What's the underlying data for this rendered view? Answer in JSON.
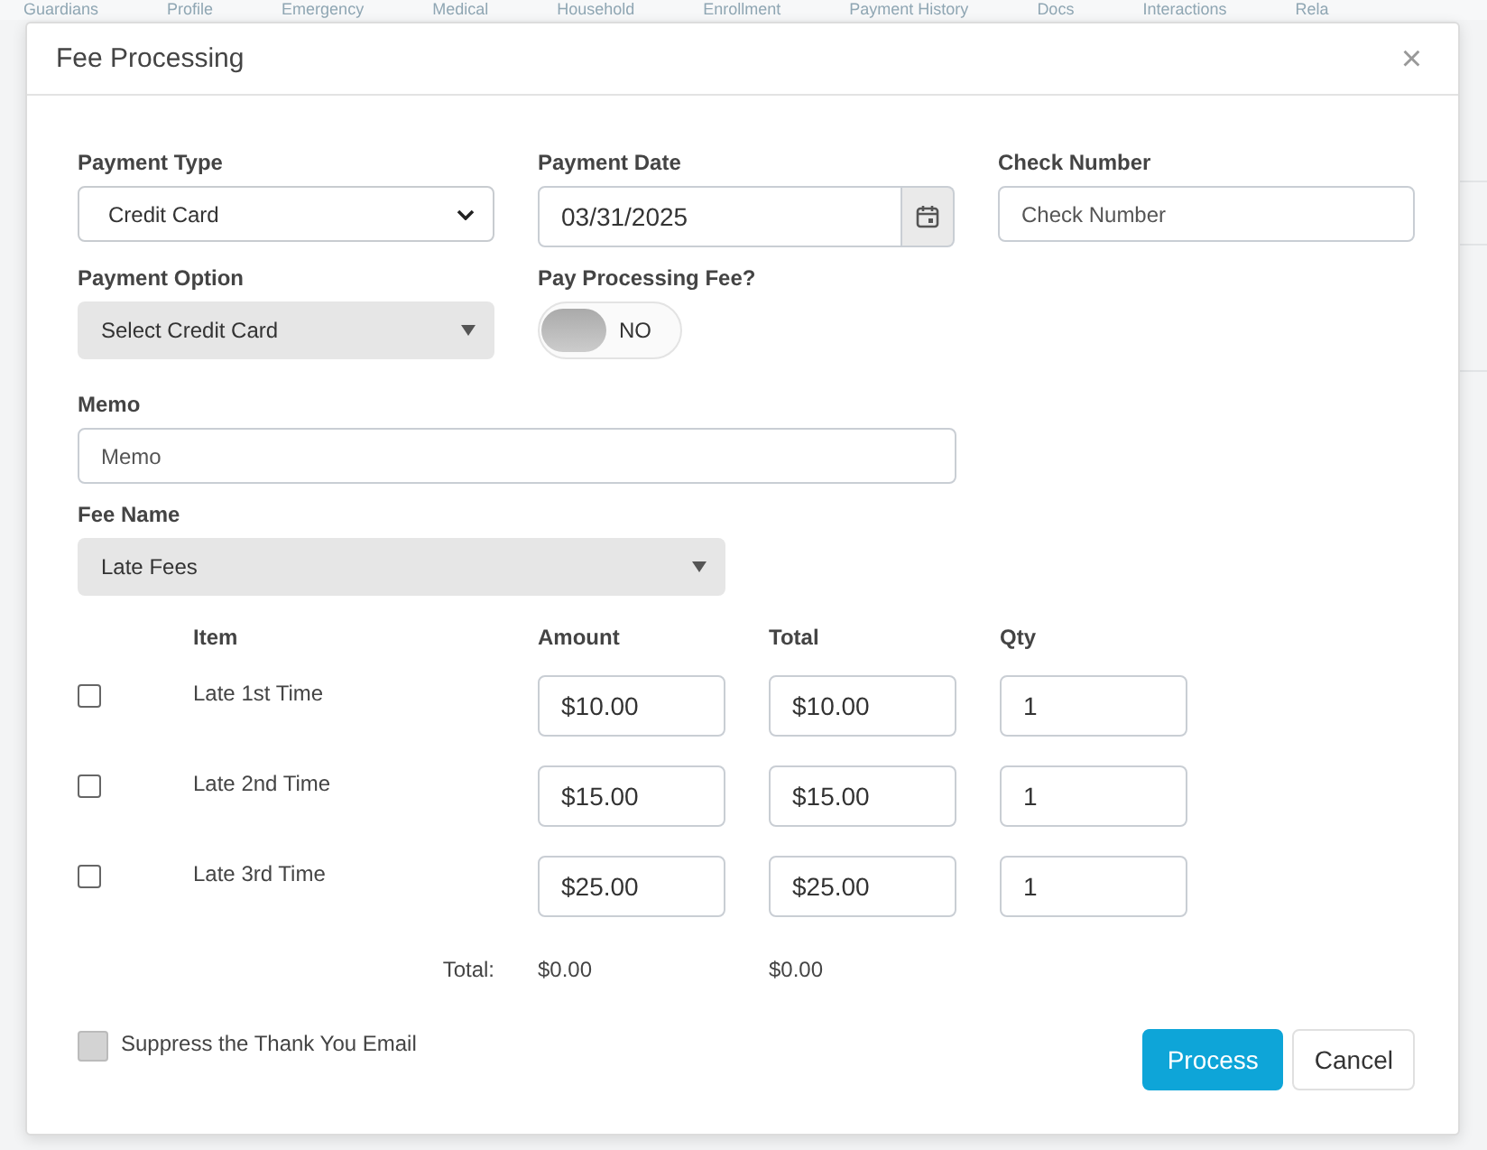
{
  "background_tabs": [
    "Guardians",
    "Profile",
    "Emergency",
    "Medical",
    "Household",
    "Enrollment",
    "Payment History",
    "Docs",
    "Interactions",
    "Rela"
  ],
  "dialog": {
    "title": "Fee Processing",
    "close": "×"
  },
  "payment_type": {
    "label": "Payment Type",
    "value": "Credit Card"
  },
  "payment_date": {
    "label": "Payment Date",
    "value": "03/31/2025"
  },
  "check_number": {
    "label": "Check Number",
    "placeholder": "Check Number"
  },
  "payment_option": {
    "label": "Payment Option",
    "value": "Select Credit Card"
  },
  "pay_processing_fee": {
    "label": "Pay Processing Fee?",
    "on": false,
    "state_label": "NO"
  },
  "memo": {
    "label": "Memo",
    "placeholder": "Memo"
  },
  "fee_name": {
    "label": "Fee Name",
    "value": "Late Fees"
  },
  "table": {
    "columns": [
      "Item",
      "Amount",
      "Total",
      "Qty"
    ],
    "rows": [
      {
        "checked": false,
        "item": "Late 1st Time",
        "amount": "$10.00",
        "total": "$10.00",
        "qty": "1"
      },
      {
        "checked": false,
        "item": "Late 2nd Time",
        "amount": "$15.00",
        "total": "$15.00",
        "qty": "1"
      },
      {
        "checked": false,
        "item": "Late 3rd Time",
        "amount": "$25.00",
        "total": "$25.00",
        "qty": "1"
      }
    ],
    "totals": {
      "label": "Total:",
      "amount": "$0.00",
      "total": "$0.00"
    }
  },
  "suppress_email": {
    "label": "Suppress the Thank You Email",
    "checked": false
  },
  "buttons": {
    "primary": "Process",
    "secondary": "Cancel"
  }
}
